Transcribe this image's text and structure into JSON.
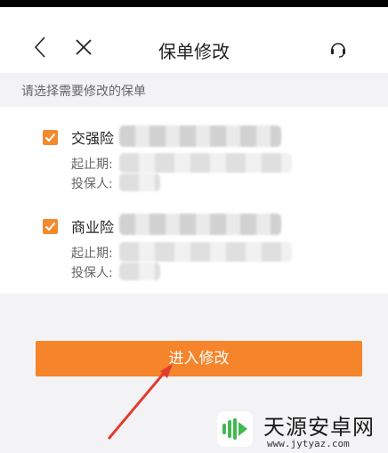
{
  "nav": {
    "title": "保单修改",
    "icons": {
      "back": "back-icon",
      "close": "close-icon",
      "support": "headset-icon"
    }
  },
  "section_label": "请选择需要修改的保单",
  "policies": [
    {
      "name": "交强险",
      "checked": true,
      "fields": {
        "period_label": "起止期:",
        "insured_label": "投保人:"
      }
    },
    {
      "name": "商业险",
      "checked": true,
      "fields": {
        "period_label": "起止期:",
        "insured_label": "投保人:"
      }
    }
  ],
  "submit_label": "进入修改",
  "watermark": {
    "title": "天源安卓网",
    "url": "www.jytyaz.com"
  },
  "colors": {
    "accent": "#f5842b",
    "checkbox": "#f28a2e",
    "annotation_arrow": "#e33b2e"
  }
}
